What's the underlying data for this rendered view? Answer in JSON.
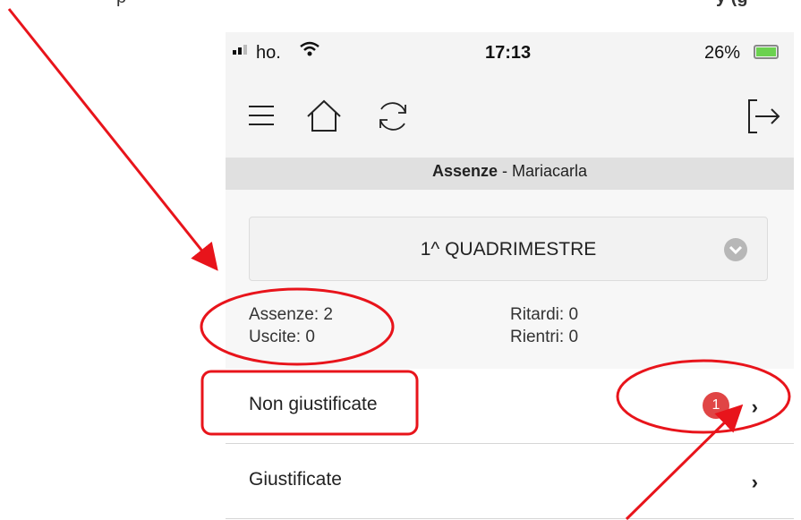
{
  "status_bar": {
    "carrier": "ho.",
    "time": "17:13",
    "battery": "26%"
  },
  "toolbar": {
    "icons": [
      "menu-icon",
      "home-icon",
      "refresh-icon",
      "logout-icon"
    ]
  },
  "header": {
    "section": "Assenze",
    "separator": " - ",
    "student": "Mariacarla"
  },
  "period_select": {
    "value": "1^ QUADRIMESTRE"
  },
  "stats": {
    "assenze": "Assenze: 2",
    "uscite": "Uscite: 0",
    "ritardi": "Ritardi: 0",
    "rientri": "Rientri: 0"
  },
  "list": {
    "items": [
      {
        "label": "Non giustificate",
        "badge": "1"
      },
      {
        "label": "Giustificate"
      }
    ]
  },
  "colors": {
    "annotation": "#e8141b",
    "badge": "#e04545",
    "battery": "#6bd14f"
  }
}
